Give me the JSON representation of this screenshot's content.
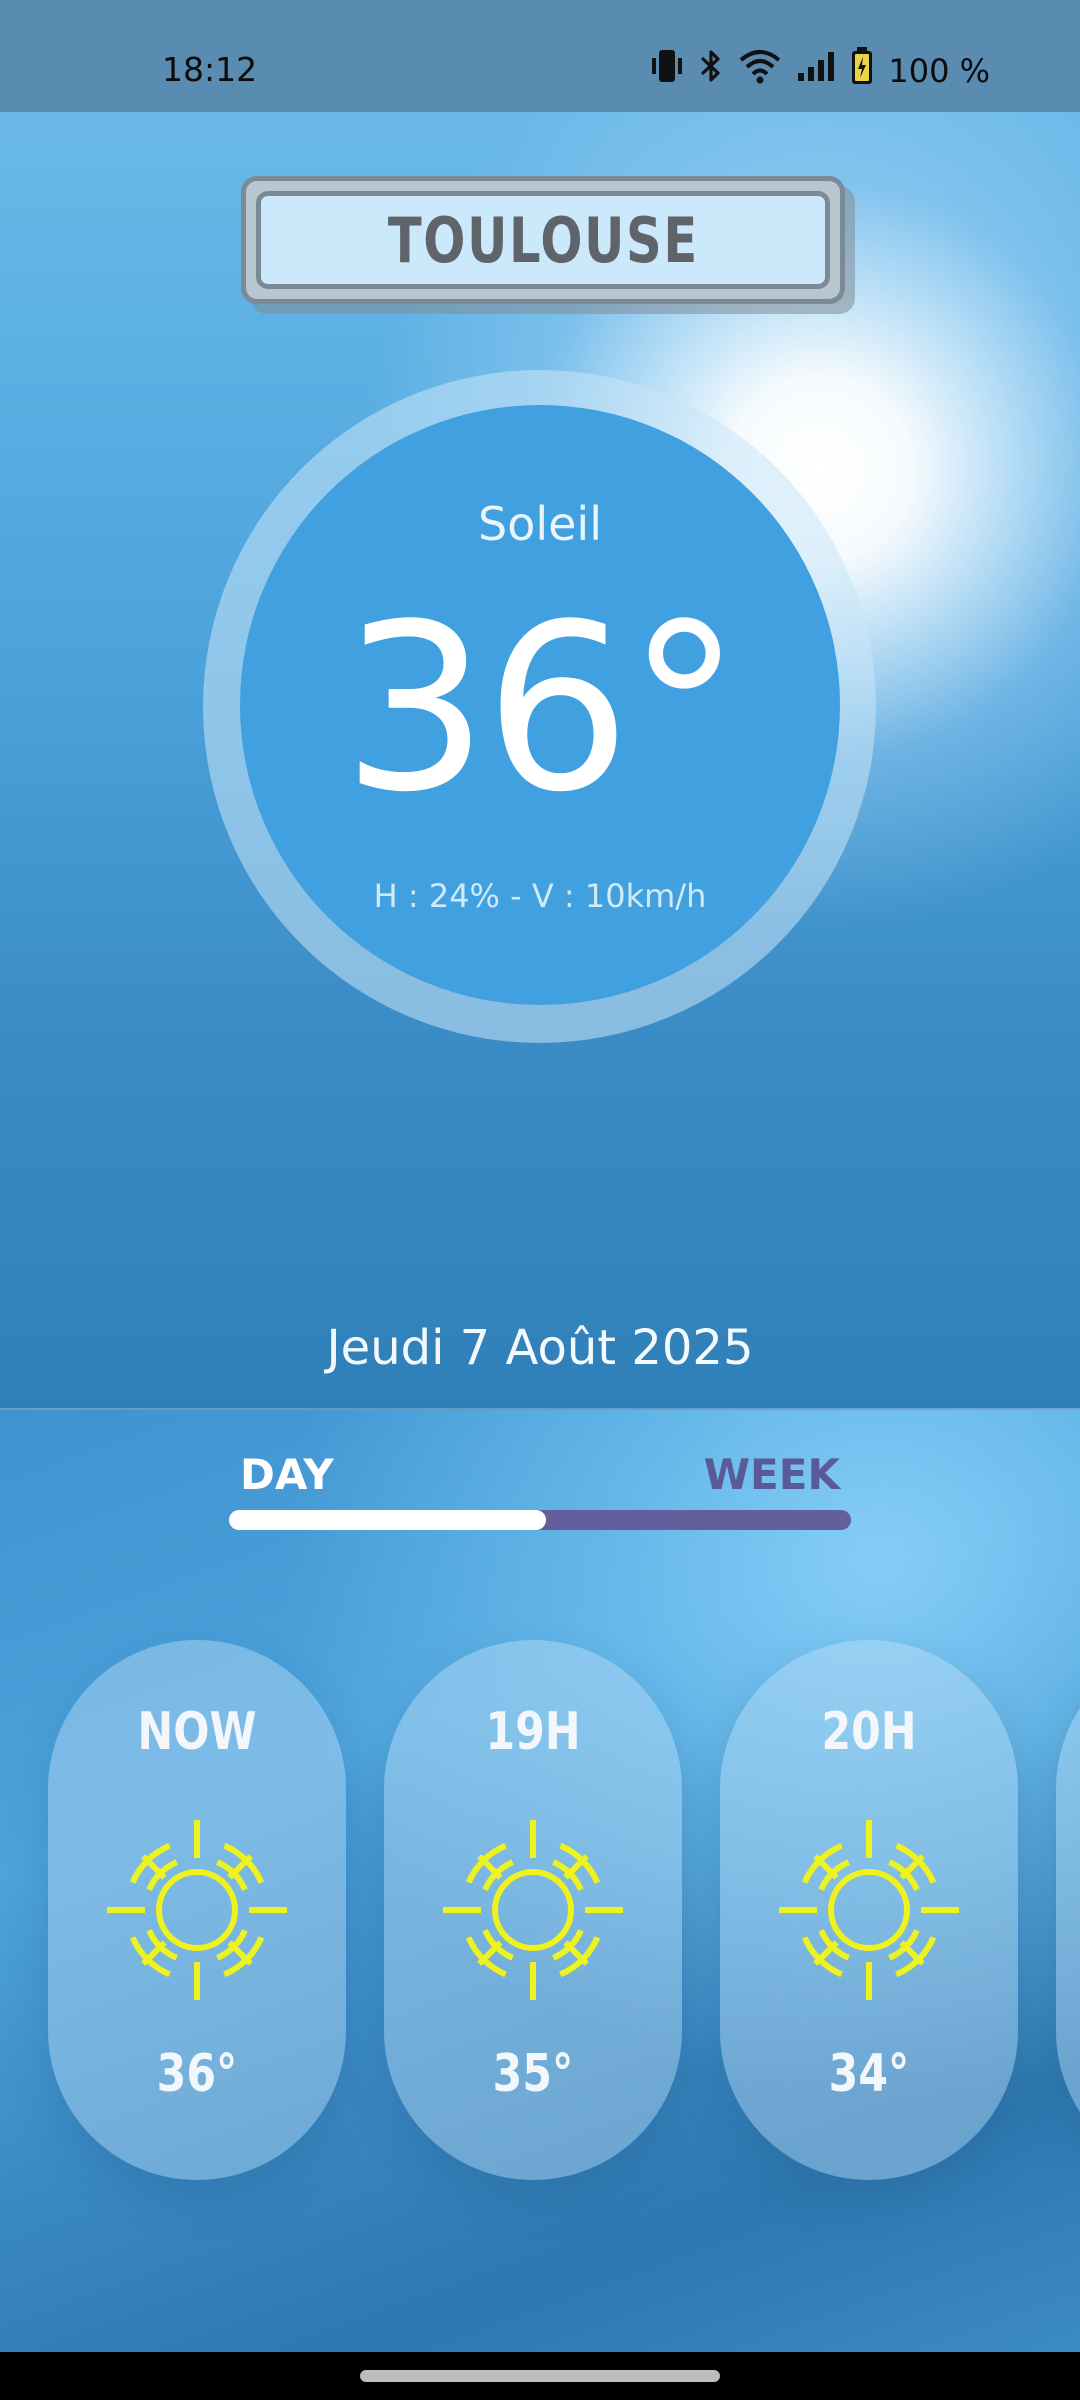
{
  "status": {
    "time": "18:12",
    "battery": "100 %",
    "icons": [
      "vibrate-icon",
      "bluetooth-icon",
      "wifi-icon",
      "signal-icon",
      "battery-charging-icon"
    ]
  },
  "location": {
    "city": "TOULOUSE"
  },
  "current": {
    "condition": "Soleil",
    "temperature": "36°",
    "details": "H : 24% - V : 10km/h"
  },
  "date": "Jeudi 7 Août 2025",
  "tabs": {
    "day": "DAY",
    "week": "WEEK",
    "active": "day",
    "indicator_fraction": 0.51
  },
  "forecast": [
    {
      "label": "NOW",
      "temp": "36°",
      "icon": "sun-icon"
    },
    {
      "label": "19H",
      "temp": "35°",
      "icon": "sun-icon"
    },
    {
      "label": "20H",
      "temp": "34°",
      "icon": "sun-icon"
    }
  ],
  "colors": {
    "sun_icon": "#eef21e",
    "disc": "#41a0df",
    "week_tab": "#5b5a99",
    "city_text": "#5e6469"
  }
}
